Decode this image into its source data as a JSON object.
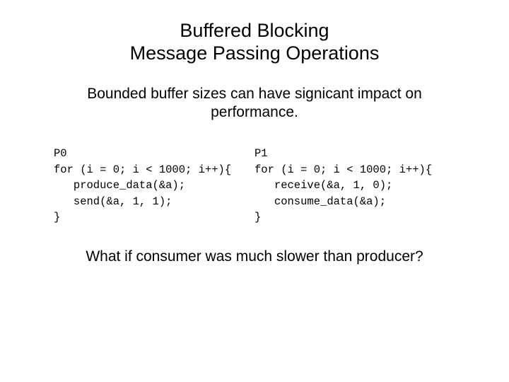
{
  "title_line1": "Buffered Blocking",
  "title_line2": "Message Passing Operations",
  "subtitle": "Bounded buffer sizes can have signicant impact on performance.",
  "code": {
    "p0": {
      "label": "P0",
      "line1": "for (i = 0; i < 1000; i++){",
      "line2": "   produce_data(&a);",
      "line3": "   send(&a, 1, 1);",
      "line4": "}"
    },
    "p1": {
      "label": "P1",
      "line1": "for (i = 0; i < 1000; i++){",
      "line2": "   receive(&a, 1, 0);",
      "line3": "   consume_data(&a);",
      "line4": "}"
    }
  },
  "question": "What if consumer was much slower than producer?"
}
